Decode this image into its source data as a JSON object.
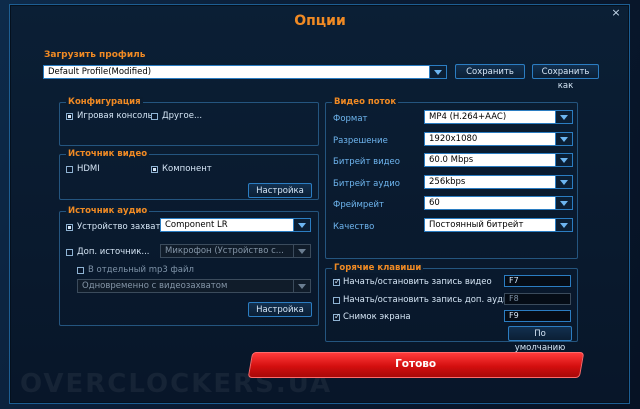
{
  "window": {
    "title": "Опции",
    "close_glyph": "×"
  },
  "profile": {
    "label": "Загрузить профиль",
    "value": "Default Profile(Modified)",
    "save": "Сохранить",
    "save_as": "Сохранить как"
  },
  "config": {
    "title": "Конфигурация",
    "game_console": "Игровая консоль",
    "game_console_checked": true,
    "other": "Другое...",
    "other_checked": false
  },
  "video_source": {
    "title": "Источник видео",
    "hdmi": "HDMI",
    "hdmi_checked": false,
    "component": "Компонент",
    "component_checked": true,
    "settings": "Настройка"
  },
  "audio_source": {
    "title": "Источник аудио",
    "capture_device": "Устройство захвата",
    "capture_device_checked": true,
    "capture_value": "Component LR",
    "extra_source": "Доп. источник...",
    "extra_source_checked": false,
    "extra_value": "Микрофон (Устройство с...",
    "mp3": "В отдельный mp3 файл",
    "mp3_checked": false,
    "mp3_value": "Одновременно с видеозахватом",
    "settings": "Настройка"
  },
  "video_stream": {
    "title": "Видео поток",
    "rows": [
      {
        "label": "Формат",
        "value": "MP4 (H.264+AAC)"
      },
      {
        "label": "Разрешение",
        "value": "1920x1080"
      },
      {
        "label": "Битрейт видео",
        "value": "60.0 Mbps"
      },
      {
        "label": "Битрейт аудио",
        "value": "256kbps"
      },
      {
        "label": "Фреймрейт",
        "value": "60"
      },
      {
        "label": "Качество",
        "value": "Постоянный битрейт"
      }
    ]
  },
  "hotkeys": {
    "title": "Горячие клавиши",
    "rows": [
      {
        "label": "Начать/остановить запись видео",
        "key": "F7",
        "checked": true
      },
      {
        "label": "Начать/остановить запись доп. аудио",
        "key": "F8",
        "checked": false
      },
      {
        "label": "Снимок экрана",
        "key": "F9",
        "checked": true
      }
    ],
    "default": "По умолчанию"
  },
  "done": "Готово",
  "watermark": "OVERCLOCKERS.UA"
}
